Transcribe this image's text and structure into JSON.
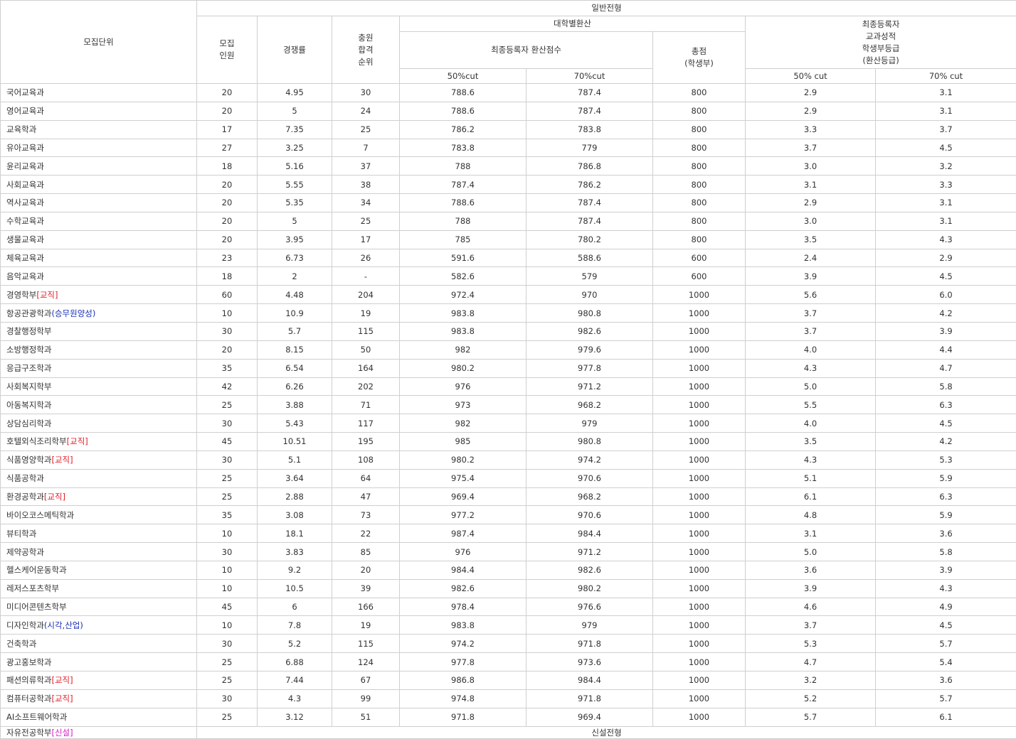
{
  "headers": {
    "unit": "모집단위",
    "general": "일반전형",
    "quota": "모집\n인원",
    "ratio": "경쟁률",
    "waitlist": "충원\n합격\n순위",
    "univ_conv": "대학별환산",
    "final_score": "최종등록자 환산점수",
    "cut50": "50%cut",
    "cut70": "70%cut",
    "total": "총점\n(학생부)",
    "final_grade": "최종등록자\n교과성적\n학생부등급\n(환산등급)",
    "grade50": "50% cut",
    "grade70": "70% cut"
  },
  "rows": [
    {
      "name": "국어교육과",
      "tag": "",
      "tag_color": "",
      "quota": "20",
      "ratio": "4.95",
      "rank": "30",
      "s50": "788.6",
      "s70": "787.4",
      "total": "800",
      "g50": "2.9",
      "g70": "3.1"
    },
    {
      "name": "영어교육과",
      "tag": "",
      "tag_color": "",
      "quota": "20",
      "ratio": "5",
      "rank": "24",
      "s50": "788.6",
      "s70": "787.4",
      "total": "800",
      "g50": "2.9",
      "g70": "3.1"
    },
    {
      "name": "교육학과",
      "tag": "",
      "tag_color": "",
      "quota": "17",
      "ratio": "7.35",
      "rank": "25",
      "s50": "786.2",
      "s70": "783.8",
      "total": "800",
      "g50": "3.3",
      "g70": "3.7"
    },
    {
      "name": "유아교육과",
      "tag": "",
      "tag_color": "",
      "quota": "27",
      "ratio": "3.25",
      "rank": "7",
      "s50": "783.8",
      "s70": "779",
      "total": "800",
      "g50": "3.7",
      "g70": "4.5"
    },
    {
      "name": "윤리교육과",
      "tag": "",
      "tag_color": "",
      "quota": "18",
      "ratio": "5.16",
      "rank": "37",
      "s50": "788",
      "s70": "786.8",
      "total": "800",
      "g50": "3.0",
      "g70": "3.2"
    },
    {
      "name": "사회교육과",
      "tag": "",
      "tag_color": "",
      "quota": "20",
      "ratio": "5.55",
      "rank": "38",
      "s50": "787.4",
      "s70": "786.2",
      "total": "800",
      "g50": "3.1",
      "g70": "3.3"
    },
    {
      "name": "역사교육과",
      "tag": "",
      "tag_color": "",
      "quota": "20",
      "ratio": "5.35",
      "rank": "34",
      "s50": "788.6",
      "s70": "787.4",
      "total": "800",
      "g50": "2.9",
      "g70": "3.1"
    },
    {
      "name": "수학교육과",
      "tag": "",
      "tag_color": "",
      "quota": "20",
      "ratio": "5",
      "rank": "25",
      "s50": "788",
      "s70": "787.4",
      "total": "800",
      "g50": "3.0",
      "g70": "3.1"
    },
    {
      "name": "생물교육과",
      "tag": "",
      "tag_color": "",
      "quota": "20",
      "ratio": "3.95",
      "rank": "17",
      "s50": "785",
      "s70": "780.2",
      "total": "800",
      "g50": "3.5",
      "g70": "4.3"
    },
    {
      "name": "체육교육과",
      "tag": "",
      "tag_color": "",
      "quota": "23",
      "ratio": "6.73",
      "rank": "26",
      "s50": "591.6",
      "s70": "588.6",
      "total": "600",
      "g50": "2.4",
      "g70": "2.9"
    },
    {
      "name": "음악교육과",
      "tag": "",
      "tag_color": "",
      "quota": "18",
      "ratio": "2",
      "rank": "-",
      "s50": "582.6",
      "s70": "579",
      "total": "600",
      "g50": "3.9",
      "g70": "4.5"
    },
    {
      "name": "경영학부",
      "tag": "[교직]",
      "tag_color": "red",
      "quota": "60",
      "ratio": "4.48",
      "rank": "204",
      "s50": "972.4",
      "s70": "970",
      "total": "1000",
      "g50": "5.6",
      "g70": "6.0"
    },
    {
      "name": "항공관광학과",
      "tag": "(승무원양성)",
      "tag_color": "blue",
      "quota": "10",
      "ratio": "10.9",
      "rank": "19",
      "s50": "983.8",
      "s70": "980.8",
      "total": "1000",
      "g50": "3.7",
      "g70": "4.2"
    },
    {
      "name": "경찰행정학부",
      "tag": "",
      "tag_color": "",
      "quota": "30",
      "ratio": "5.7",
      "rank": "115",
      "s50": "983.8",
      "s70": "982.6",
      "total": "1000",
      "g50": "3.7",
      "g70": "3.9"
    },
    {
      "name": "소방행정학과",
      "tag": "",
      "tag_color": "",
      "quota": "20",
      "ratio": "8.15",
      "rank": "50",
      "s50": "982",
      "s70": "979.6",
      "total": "1000",
      "g50": "4.0",
      "g70": "4.4"
    },
    {
      "name": "응급구조학과",
      "tag": "",
      "tag_color": "",
      "quota": "35",
      "ratio": "6.54",
      "rank": "164",
      "s50": "980.2",
      "s70": "977.8",
      "total": "1000",
      "g50": "4.3",
      "g70": "4.7"
    },
    {
      "name": "사회복지학부",
      "tag": "",
      "tag_color": "",
      "quota": "42",
      "ratio": "6.26",
      "rank": "202",
      "s50": "976",
      "s70": "971.2",
      "total": "1000",
      "g50": "5.0",
      "g70": "5.8"
    },
    {
      "name": "아동복지학과",
      "tag": "",
      "tag_color": "",
      "quota": "25",
      "ratio": "3.88",
      "rank": "71",
      "s50": "973",
      "s70": "968.2",
      "total": "1000",
      "g50": "5.5",
      "g70": "6.3"
    },
    {
      "name": "상담심리학과",
      "tag": "",
      "tag_color": "",
      "quota": "30",
      "ratio": "5.43",
      "rank": "117",
      "s50": "982",
      "s70": "979",
      "total": "1000",
      "g50": "4.0",
      "g70": "4.5"
    },
    {
      "name": "호텔외식조리학부",
      "tag": "[교직]",
      "tag_color": "red",
      "quota": "45",
      "ratio": "10.51",
      "rank": "195",
      "s50": "985",
      "s70": "980.8",
      "total": "1000",
      "g50": "3.5",
      "g70": "4.2"
    },
    {
      "name": "식품영양학과",
      "tag": "[교직]",
      "tag_color": "red",
      "quota": "30",
      "ratio": "5.1",
      "rank": "108",
      "s50": "980.2",
      "s70": "974.2",
      "total": "1000",
      "g50": "4.3",
      "g70": "5.3"
    },
    {
      "name": "식품공학과",
      "tag": "",
      "tag_color": "",
      "quota": "25",
      "ratio": "3.64",
      "rank": "64",
      "s50": "975.4",
      "s70": "970.6",
      "total": "1000",
      "g50": "5.1",
      "g70": "5.9"
    },
    {
      "name": "환경공학과",
      "tag": "[교직]",
      "tag_color": "red",
      "quota": "25",
      "ratio": "2.88",
      "rank": "47",
      "s50": "969.4",
      "s70": "968.2",
      "total": "1000",
      "g50": "6.1",
      "g70": "6.3"
    },
    {
      "name": "바이오코스메틱학과",
      "tag": "",
      "tag_color": "",
      "quota": "35",
      "ratio": "3.08",
      "rank": "73",
      "s50": "977.2",
      "s70": "970.6",
      "total": "1000",
      "g50": "4.8",
      "g70": "5.9"
    },
    {
      "name": "뷰티학과",
      "tag": "",
      "tag_color": "",
      "quota": "10",
      "ratio": "18.1",
      "rank": "22",
      "s50": "987.4",
      "s70": "984.4",
      "total": "1000",
      "g50": "3.1",
      "g70": "3.6"
    },
    {
      "name": "제약공학과",
      "tag": "",
      "tag_color": "",
      "quota": "30",
      "ratio": "3.83",
      "rank": "85",
      "s50": "976",
      "s70": "971.2",
      "total": "1000",
      "g50": "5.0",
      "g70": "5.8"
    },
    {
      "name": "헬스케어운동학과",
      "tag": "",
      "tag_color": "",
      "quota": "10",
      "ratio": "9.2",
      "rank": "20",
      "s50": "984.4",
      "s70": "982.6",
      "total": "1000",
      "g50": "3.6",
      "g70": "3.9"
    },
    {
      "name": "레저스포츠학부",
      "tag": "",
      "tag_color": "",
      "quota": "10",
      "ratio": "10.5",
      "rank": "39",
      "s50": "982.6",
      "s70": "980.2",
      "total": "1000",
      "g50": "3.9",
      "g70": "4.3"
    },
    {
      "name": "미디어콘텐츠학부",
      "tag": "",
      "tag_color": "",
      "quota": "45",
      "ratio": "6",
      "rank": "166",
      "s50": "978.4",
      "s70": "976.6",
      "total": "1000",
      "g50": "4.6",
      "g70": "4.9"
    },
    {
      "name": "디자인학과",
      "tag": "(시각,산업)",
      "tag_color": "blue",
      "quota": "10",
      "ratio": "7.8",
      "rank": "19",
      "s50": "983.8",
      "s70": "979",
      "total": "1000",
      "g50": "3.7",
      "g70": "4.5"
    },
    {
      "name": "건축학과",
      "tag": "",
      "tag_color": "",
      "quota": "30",
      "ratio": "5.2",
      "rank": "115",
      "s50": "974.2",
      "s70": "971.8",
      "total": "1000",
      "g50": "5.3",
      "g70": "5.7"
    },
    {
      "name": "광고홍보학과",
      "tag": "",
      "tag_color": "",
      "quota": "25",
      "ratio": "6.88",
      "rank": "124",
      "s50": "977.8",
      "s70": "973.6",
      "total": "1000",
      "g50": "4.7",
      "g70": "5.4"
    },
    {
      "name": "패션의류학과",
      "tag": "[교직]",
      "tag_color": "red",
      "quota": "25",
      "ratio": "7.44",
      "rank": "67",
      "s50": "986.8",
      "s70": "984.4",
      "total": "1000",
      "g50": "3.2",
      "g70": "3.6"
    },
    {
      "name": "컴퓨터공학과",
      "tag": "[교직]",
      "tag_color": "red",
      "quota": "30",
      "ratio": "4.3",
      "rank": "99",
      "s50": "974.8",
      "s70": "971.8",
      "total": "1000",
      "g50": "5.2",
      "g70": "5.7"
    },
    {
      "name": "AI소프트웨어학과",
      "tag": "",
      "tag_color": "",
      "quota": "25",
      "ratio": "3.12",
      "rank": "51",
      "s50": "971.8",
      "s70": "969.4",
      "total": "1000",
      "g50": "5.7",
      "g70": "6.1"
    }
  ],
  "last_row": {
    "name": "자유전공학부",
    "tag": "[신설]",
    "tag_color": "pink",
    "note": "신설전형"
  }
}
